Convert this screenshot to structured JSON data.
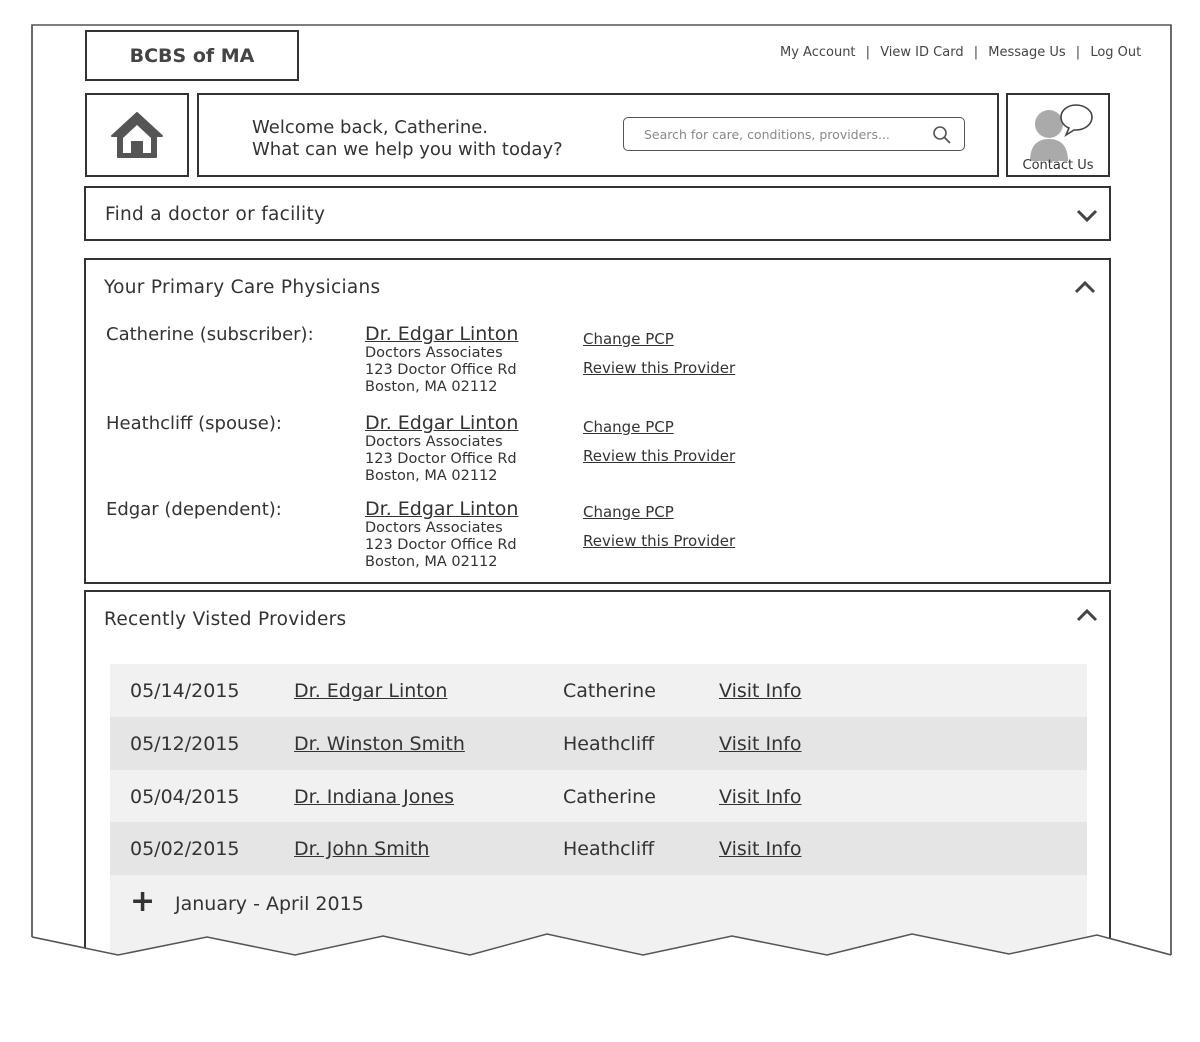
{
  "brand": {
    "logo_text": "BCBS of MA"
  },
  "top_nav": {
    "my_account": "My Account",
    "view_id_card": "View ID Card",
    "message_us": "Message Us",
    "log_out": "Log Out",
    "separator": "|"
  },
  "welcome": {
    "line1": "Welcome back, Catherine.",
    "line2": "What can we help you with today?"
  },
  "search": {
    "placeholder": "Search for care, conditions, providers..."
  },
  "contact": {
    "label": "Contact Us"
  },
  "find_doctor": {
    "title": "Find a doctor or facility"
  },
  "pcp_section": {
    "title": "Your Primary Care Physicians",
    "members": [
      {
        "member": "Catherine (subscriber):",
        "doctor": "Dr. Edgar Linton",
        "practice": "Doctors Associates",
        "street": "123 Doctor Office Rd",
        "city": "Boston, MA 02112",
        "change": "Change PCP",
        "review": "Review this Provider"
      },
      {
        "member": "Heathcliff (spouse):",
        "doctor": "Dr. Edgar Linton",
        "practice": "Doctors Associates",
        "street": "123 Doctor Office Rd",
        "city": "Boston, MA 02112",
        "change": "Change PCP",
        "review": "Review this Provider"
      },
      {
        "member": "Edgar (dependent):",
        "doctor": "Dr. Edgar Linton",
        "practice": "Doctors Associates",
        "street": "123 Doctor Office Rd",
        "city": "Boston, MA 02112",
        "change": "Change PCP",
        "review": "Review this Provider"
      }
    ]
  },
  "recent_section": {
    "title": "Recently Visted Providers",
    "rows": [
      {
        "date": "05/14/2015",
        "provider": "Dr. Edgar Linton",
        "patient": "Catherine",
        "link": "Visit Info"
      },
      {
        "date": "05/12/2015",
        "provider": "Dr. Winston Smith",
        "patient": "Heathcliff",
        "link": "Visit Info"
      },
      {
        "date": "05/04/2015",
        "provider": "Dr. Indiana Jones",
        "patient": "Catherine",
        "link": "Visit Info"
      },
      {
        "date": "05/02/2015",
        "provider": "Dr. John Smith",
        "patient": "Heathcliff",
        "link": "Visit Info"
      }
    ],
    "group": {
      "label": "January - April 2015"
    }
  },
  "colors": {
    "line": "#333333",
    "row_light": "#f1f1f1",
    "row_dark": "#e5e5e5",
    "icon_gray": "#555555"
  },
  "icons": {
    "home": "home-icon",
    "search": "search-icon",
    "contact": "contact-person-chat-icon",
    "chevron_down": "chevron-down-icon",
    "chevron_up": "chevron-up-icon",
    "expand": "plus-icon"
  }
}
